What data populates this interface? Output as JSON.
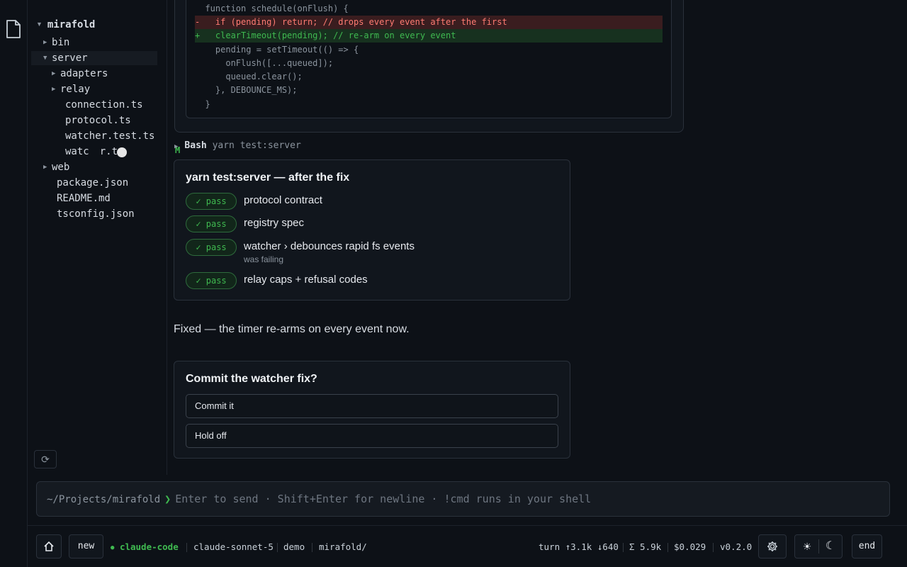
{
  "tree": {
    "root": "mirafold",
    "items": [
      {
        "label": "bin",
        "depth": 1,
        "folder": true,
        "open": false
      },
      {
        "label": "server",
        "depth": 1,
        "folder": true,
        "open": true
      },
      {
        "label": "adapters",
        "depth": 2,
        "folder": true,
        "open": false
      },
      {
        "label": "relay",
        "depth": 2,
        "folder": true,
        "open": false
      },
      {
        "label": "connection.ts",
        "depth": 2,
        "folder": false
      },
      {
        "label": "protocol.ts",
        "depth": 2,
        "folder": false
      },
      {
        "label": "watcher.test.ts",
        "depth": 2,
        "folder": false
      },
      {
        "label": "watcher.ts",
        "depth": 2,
        "folder": false,
        "badge": "M"
      },
      {
        "label": "web",
        "depth": 1,
        "folder": true,
        "open": false
      },
      {
        "label": "package.json",
        "depth": 1,
        "folder": false
      },
      {
        "label": "README.md",
        "depth": 1,
        "folder": false
      },
      {
        "label": "tsconfig.json",
        "depth": 1,
        "folder": false
      }
    ],
    "visible_labels": [
      "bin",
      "server",
      "adapters",
      "relay",
      "connection.ts",
      "protocol.ts",
      "watcher.test.ts",
      "watc",
      "r.ts",
      "web",
      "package.json",
      "README.md",
      "tsconfig.json"
    ],
    "modified_badge": "M"
  },
  "diff": {
    "lines": [
      {
        "kind": "ctx",
        "text": "  function schedule(onFlush) {"
      },
      {
        "kind": "del",
        "text": "-   if (pending) return; // drops every event after the first"
      },
      {
        "kind": "add",
        "text": "+   clearTimeout(pending); // re-arm on every event"
      },
      {
        "kind": "ctx",
        "text": "    pending = setTimeout(() => {"
      },
      {
        "kind": "ctx",
        "text": "      onFlush([...queued]);"
      },
      {
        "kind": "ctx",
        "text": "      queued.clear();"
      },
      {
        "kind": "ctx",
        "text": "    }, DEBOUNCE_MS);"
      },
      {
        "kind": "ctx",
        "text": "  }"
      }
    ]
  },
  "bash": {
    "tool": "Bash",
    "command": "yarn test:server"
  },
  "tests": {
    "title": "yarn test:server — after the fix",
    "pass_label": "✓ pass",
    "rows": [
      {
        "name": "protocol contract",
        "note": ""
      },
      {
        "name": "registry spec",
        "note": ""
      },
      {
        "name": "watcher › debounces rapid fs events",
        "note": "was failing"
      },
      {
        "name": "relay caps + refusal codes",
        "note": ""
      }
    ]
  },
  "reply": "Fixed — the timer re-arms on every event now.",
  "question": {
    "title": "Commit the watcher fix?",
    "options": [
      "Commit it",
      "Hold off"
    ]
  },
  "input": {
    "path": "~/Projects/mirafold",
    "prompt": "❯",
    "placeholder": "Enter to send · Shift+Enter for newline · !cmd runs in your shell"
  },
  "status": {
    "new_label": "new",
    "agent": "claude-code",
    "model": "claude-sonnet-5",
    "mode": "demo",
    "dir": "mirafold/",
    "turn": "turn ↑3.1k ↓640",
    "total": "Σ 5.9k",
    "cost": "$0.029",
    "version": "v0.2.0",
    "end_label": "end"
  },
  "colors": {
    "accent_green": "#3fb950",
    "deleted_red": "#ff7b72",
    "background": "#0d1117"
  }
}
